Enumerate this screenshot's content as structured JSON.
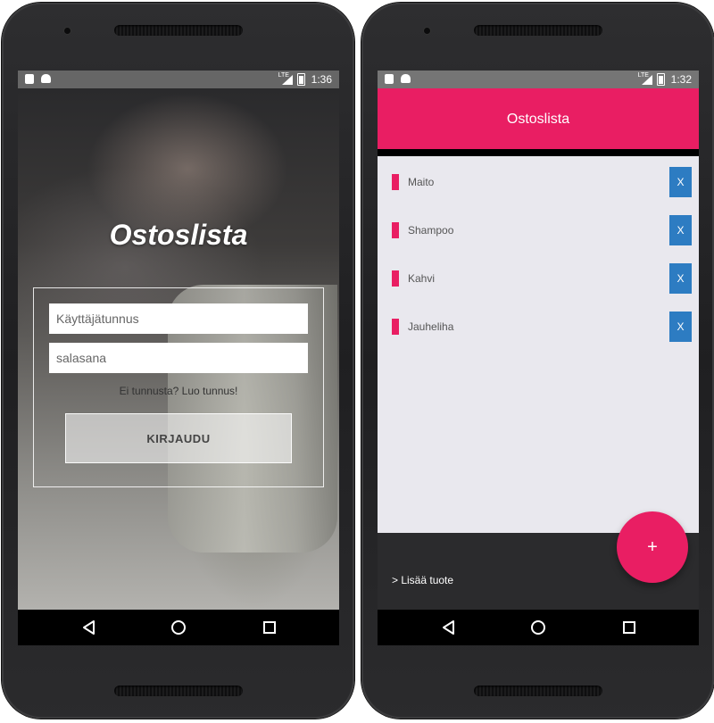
{
  "left_screen": {
    "status_bar": {
      "time": "1:36",
      "network": "LTE"
    },
    "app_title": "Ostoslista",
    "username_placeholder": "Käyttäjätunnus",
    "password_placeholder": "salasana",
    "signup_link": "Ei tunnusta? Luo tunnus!",
    "login_button": "KIRJAUDU"
  },
  "right_screen": {
    "status_bar": {
      "time": "1:32",
      "network": "LTE"
    },
    "app_title": "Ostoslista",
    "items": [
      {
        "label": "Maito",
        "delete_label": "X"
      },
      {
        "label": "Shampoo",
        "delete_label": "X"
      },
      {
        "label": "Kahvi",
        "delete_label": "X"
      },
      {
        "label": "Jauheliha",
        "delete_label": "X"
      }
    ],
    "add_item_label": "> Lisää tuote",
    "fab_label": "+"
  },
  "colors": {
    "accent": "#e91e63",
    "delete_button": "#2d7cc2",
    "list_background": "#e9e8ee"
  },
  "icons": {
    "status_left": [
      "sd-card-icon",
      "android-icon"
    ],
    "status_right": [
      "signal-icon",
      "battery-icon"
    ],
    "nav": [
      "back-icon",
      "home-icon",
      "recents-icon"
    ]
  }
}
